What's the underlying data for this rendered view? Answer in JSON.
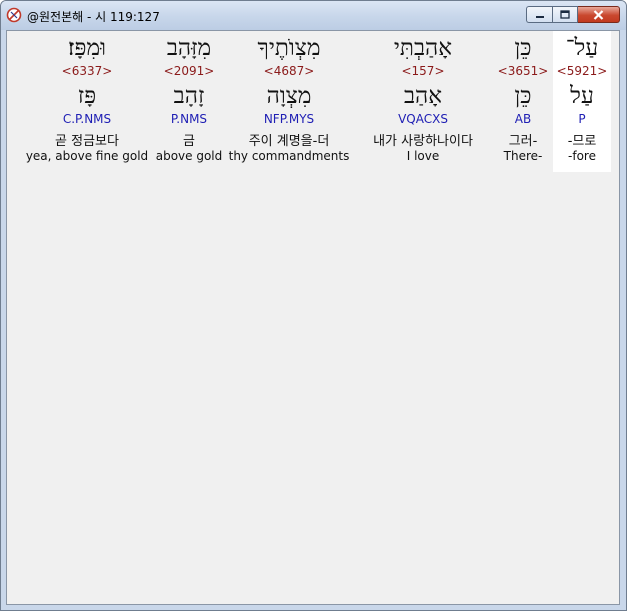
{
  "window": {
    "title": "@원전본해 - 시 119:127"
  },
  "words": [
    {
      "heb": "עַל־",
      "strong": "<5921>",
      "lemma": "עַל",
      "morph": "P",
      "korean": "-므로",
      "english": "-fore",
      "selected": true
    },
    {
      "heb": "כֵּן",
      "strong": "<3651>",
      "lemma": "כֵּן",
      "morph": "AB",
      "korean": "그러-",
      "english": "There-",
      "selected": false
    },
    {
      "heb": "אָהַבְתִּי",
      "strong": "<157>",
      "lemma": "אָהַב",
      "morph": "VQACXS",
      "korean": "내가 사랑하나이다",
      "english": "I love",
      "selected": false
    },
    {
      "heb": "מִצְוֺתֶיךָ",
      "strong": "<4687>",
      "lemma": "מִצְוָה",
      "morph": "NFP.MYS",
      "korean": "주이 계명을-더",
      "english": "thy commandments",
      "selected": false
    },
    {
      "heb": "מִזָּהָב",
      "strong": "<2091>",
      "lemma": "זָהָב",
      "morph": "P.NMS",
      "korean": "금",
      "english": "above gold",
      "selected": false
    },
    {
      "heb": "וּמִפָּז׃",
      "strong": "<6337>",
      "lemma": "פָּז",
      "morph": "C.P.NMS",
      "korean": "곧 정금보다",
      "english": "yea, above fine gold",
      "selected": false
    }
  ]
}
